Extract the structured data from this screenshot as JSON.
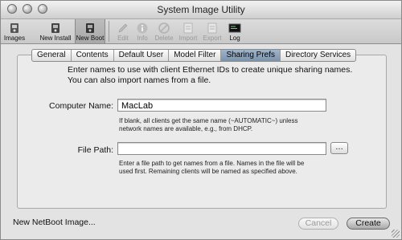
{
  "window": {
    "title": "System Image Utility"
  },
  "toolbar": {
    "items": [
      {
        "label": "Images",
        "icon": "disk-icon",
        "enabled": true,
        "selected": false
      },
      {
        "label": "New Install",
        "icon": "install-icon",
        "enabled": true,
        "selected": false
      },
      {
        "label": "New Boot",
        "icon": "boot-icon",
        "enabled": true,
        "selected": true
      },
      {
        "label": "Edit",
        "icon": "pencil-icon",
        "enabled": false,
        "selected": false
      },
      {
        "label": "Info",
        "icon": "info-icon",
        "enabled": false,
        "selected": false
      },
      {
        "label": "Delete",
        "icon": "delete-icon",
        "enabled": false,
        "selected": false
      },
      {
        "label": "Import",
        "icon": "import-icon",
        "enabled": false,
        "selected": false
      },
      {
        "label": "Export",
        "icon": "export-icon",
        "enabled": false,
        "selected": false
      },
      {
        "label": "Log",
        "icon": "log-icon",
        "enabled": true,
        "selected": false
      }
    ]
  },
  "tabs": [
    {
      "label": "General",
      "active": false
    },
    {
      "label": "Contents",
      "active": false
    },
    {
      "label": "Default User",
      "active": false
    },
    {
      "label": "Model Filter",
      "active": false
    },
    {
      "label": "Sharing Prefs",
      "active": true
    },
    {
      "label": "Directory Services",
      "active": false
    }
  ],
  "intro": {
    "line1": "Enter names to use with client Ethernet IDs to create unique sharing names.",
    "line2": "You can also import names from a file."
  },
  "computer_name": {
    "label": "Computer Name:",
    "value": "MacLab",
    "hint_line1": "If blank, all clients get the same name (~AUTOMATIC~) unless",
    "hint_line2": "network names are available, e.g., from DHCP."
  },
  "file_path": {
    "label": "File Path:",
    "value": "",
    "browse_label": "…",
    "hint_line1": "Enter a file path to get names from a file. Names in the file will be",
    "hint_line2": "used first. Remaining clients will be named as specified above."
  },
  "footer": {
    "image_name": "New NetBoot Image...",
    "cancel_label": "Cancel",
    "create_label": "Create"
  }
}
